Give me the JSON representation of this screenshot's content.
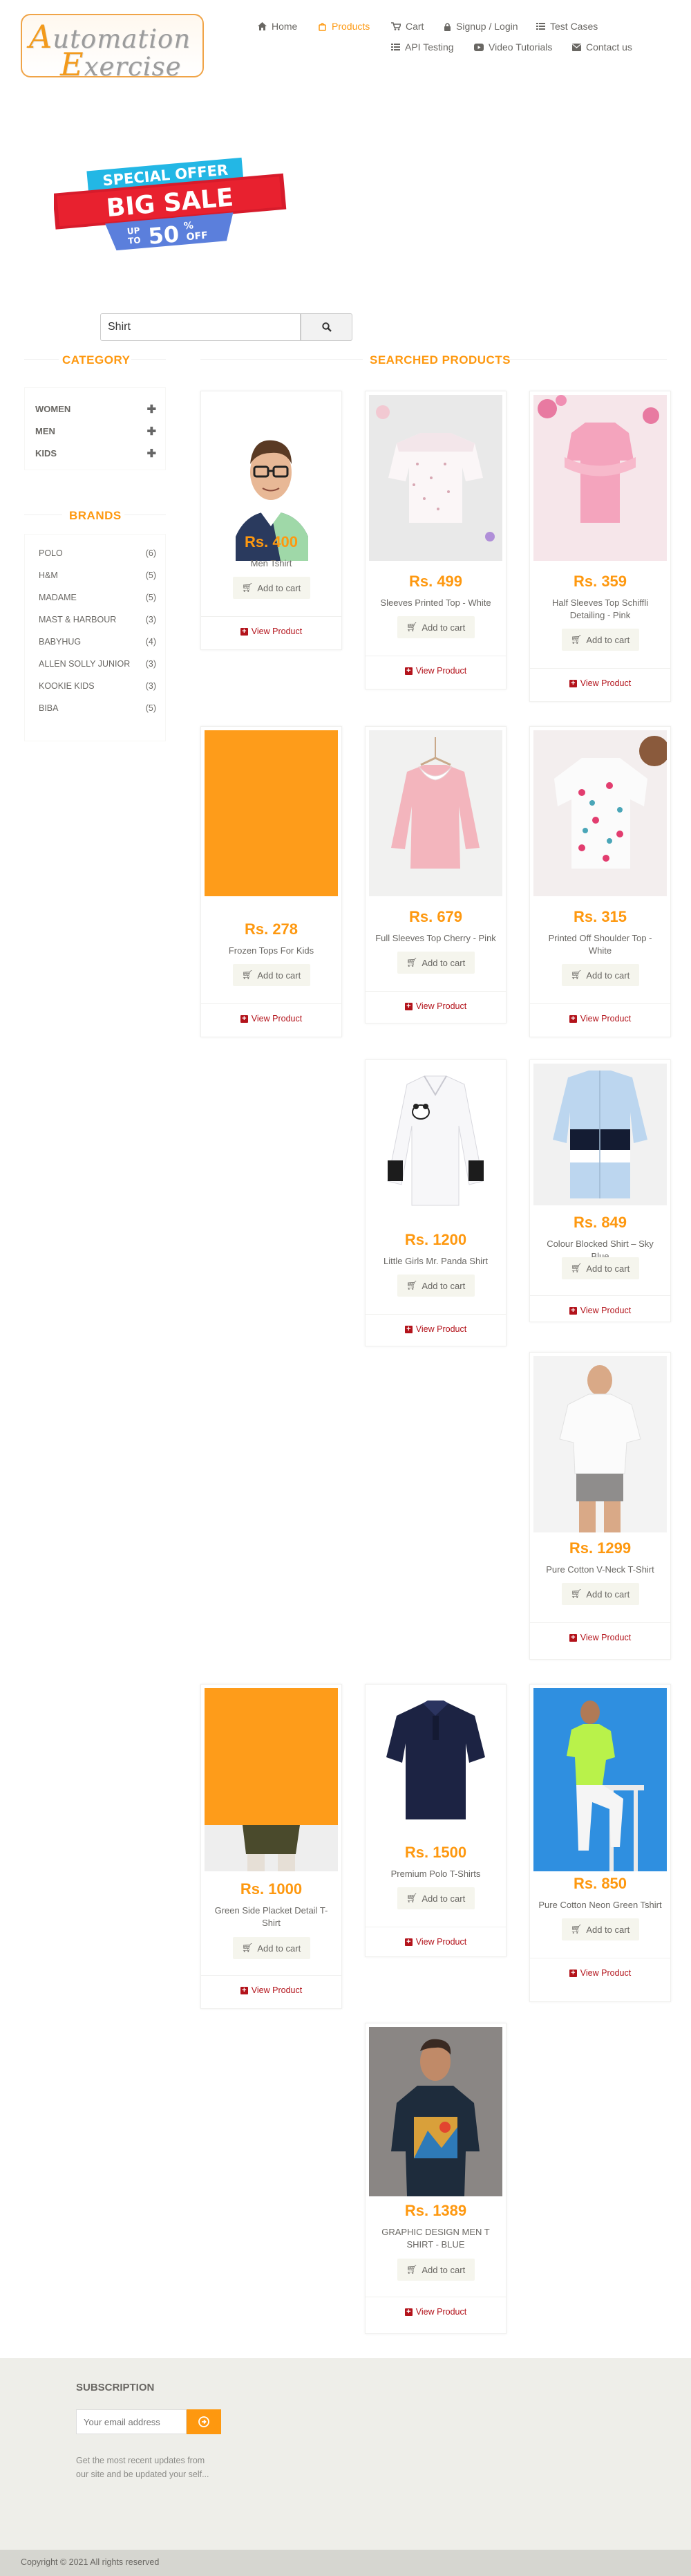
{
  "header": {
    "logo_line1_cap": "A",
    "logo_line1_rest": "utomation",
    "logo_line2_cap": "E",
    "logo_line2_rest": "xercise",
    "nav": {
      "home": "Home",
      "products": "Products",
      "cart": "Cart",
      "signup_login": "Signup / Login",
      "test_cases": "Test Cases",
      "api_testing": "API Testing",
      "video_tutorials": "Video Tutorials",
      "contact_us": "Contact us"
    }
  },
  "banner": {
    "special_offer": "SPECIAL OFFER",
    "big_sale": "BIG SALE",
    "up_to": "UP",
    "to": "TO",
    "percent": "50",
    "percent_sign": "%",
    "off": "OFF"
  },
  "search": {
    "value": "Shirt",
    "icon": "search-icon"
  },
  "sidebar": {
    "category_title": "CATEGORY",
    "categories": [
      {
        "label": "WOMEN"
      },
      {
        "label": "MEN"
      },
      {
        "label": "KIDS"
      }
    ],
    "brands_title": "BRANDS",
    "brands": [
      {
        "name": "POLO",
        "count": "(6)"
      },
      {
        "name": "H&M",
        "count": "(5)"
      },
      {
        "name": "MADAME",
        "count": "(5)"
      },
      {
        "name": "MAST & HARBOUR",
        "count": "(3)"
      },
      {
        "name": "BABYHUG",
        "count": "(4)"
      },
      {
        "name": "ALLEN SOLLY JUNIOR",
        "count": "(3)"
      },
      {
        "name": "KOOKIE KIDS",
        "count": "(3)"
      },
      {
        "name": "BIBA",
        "count": "(5)"
      }
    ]
  },
  "main": {
    "title": "SEARCHED PRODUCTS",
    "add_to_cart": "Add to cart",
    "view_product": "View Product",
    "products": [
      {
        "price": "Rs. 400",
        "name": "Men Tshirt"
      },
      {
        "price": "Rs. 499",
        "name": "Sleeves Printed Top - White"
      },
      {
        "price": "Rs. 359",
        "name": "Half Sleeves Top Schiffli Detailing - Pink"
      },
      {
        "price": "Rs. 278",
        "name": "Frozen Tops For Kids"
      },
      {
        "price": "Rs. 679",
        "name": "Full Sleeves Top Cherry - Pink"
      },
      {
        "price": "Rs. 315",
        "name": "Printed Off Shoulder Top - White"
      },
      {
        "price": "Rs. 1200",
        "name": "Little Girls Mr. Panda Shirt"
      },
      {
        "price": "Rs. 849",
        "name": "Colour Blocked Shirt – Sky Blue"
      },
      {
        "price": "Rs. 1299",
        "name": "Pure Cotton V-Neck T-Shirt"
      },
      {
        "price": "Rs. 1000",
        "name": "Green Side Placket Detail T-Shirt"
      },
      {
        "price": "Rs. 1500",
        "name": "Premium Polo T-Shirts"
      },
      {
        "price": "Rs. 850",
        "name": "Pure Cotton Neon Green Tshirt"
      },
      {
        "price": "Rs. 1389",
        "name": "GRAPHIC DESIGN MEN T SHIRT - BLUE"
      }
    ]
  },
  "footer": {
    "subscription_title": "SUBSCRIPTION",
    "email_placeholder": "Your email address",
    "subscription_text_line1": "Get the most recent updates from",
    "subscription_text_line2": "our site and be updated your self...",
    "copyright": "Copyright © 2021 All rights reserved"
  },
  "colors": {
    "accent": "#fe980f",
    "view_product": "#b3131b",
    "footer_bg": "#eeeee9"
  }
}
